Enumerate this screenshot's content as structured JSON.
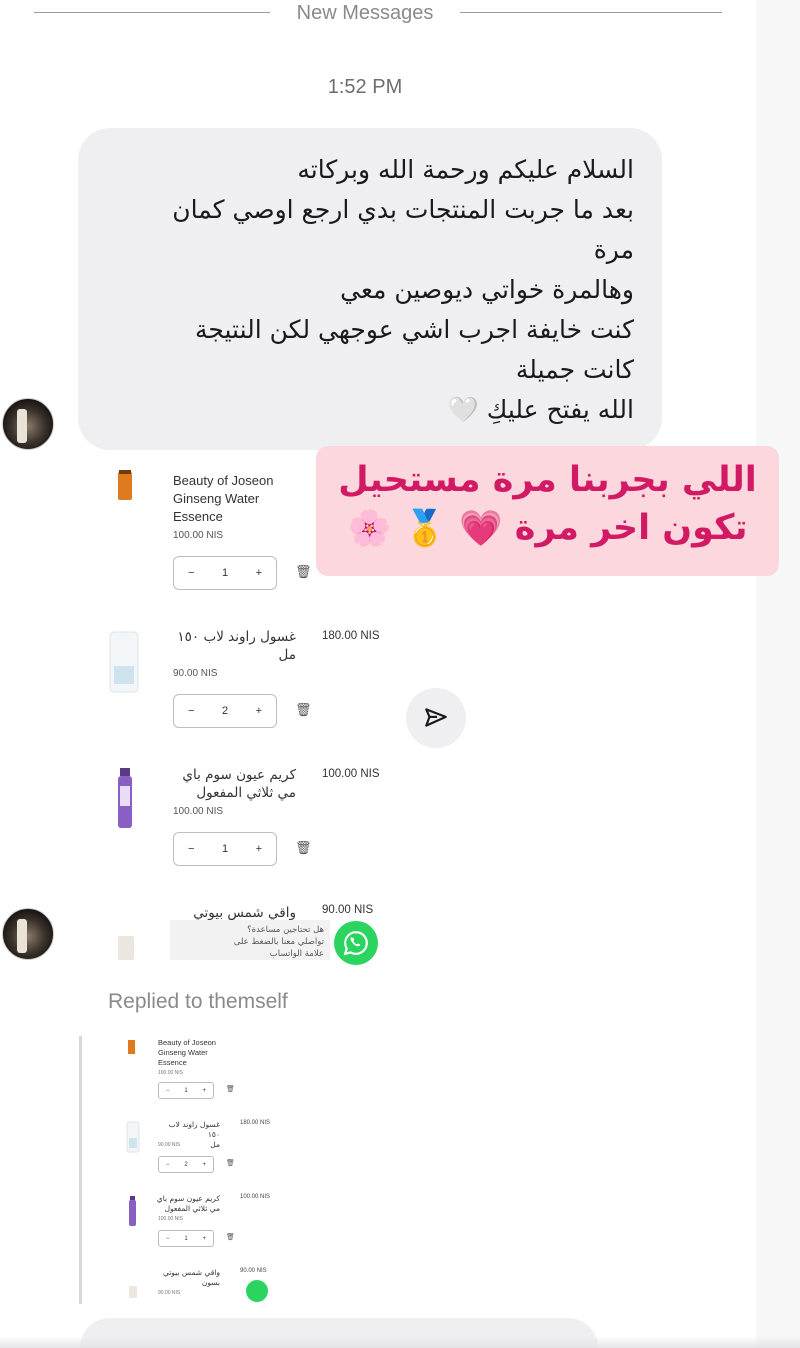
{
  "divider": {
    "label": "New Messages"
  },
  "timestamp": "1:52 PM",
  "message": {
    "lines": [
      "السلام عليكم ورحمة الله وبركاته",
      "بعد ما جربت المنتجات بدي ارجع اوصي كمان",
      "مرة",
      "وهالمرة خواتي ديوصين معي",
      "كنت خايفة اجرب اشي عوجهي لكن النتيجة",
      "كانت جميلة",
      "الله يفتح عليكِ 🤍"
    ]
  },
  "banner": {
    "line1": "اللي بجربنا مرة مستحيل",
    "line2": "تكون اخر مرة",
    "emojis": [
      "💗",
      "🥇",
      "🌸"
    ]
  },
  "cart": {
    "items": [
      {
        "name": "Beauty of Joseon Ginseng Water Essence",
        "name_lines": [
          "Beauty of Joseon",
          "Ginseng Water",
          "Essence"
        ],
        "unit_price": "100.00 NIS",
        "total": "",
        "qty": "1",
        "color": "#e07a1f"
      },
      {
        "name_lines": [
          "غسول راوند لاب ١٥٠",
          "مل"
        ],
        "unit_price": "90.00 NIS",
        "total": "180.00 NIS",
        "qty": "2",
        "color": "#cfe3ec"
      },
      {
        "name_lines": [
          "كريم عيون سوم باي",
          "مي ثلاثي المفعول"
        ],
        "unit_price": "100.00 NIS",
        "total": "100.00 NIS",
        "qty": "1",
        "color": "#7a4fb3"
      },
      {
        "name_lines": [
          "واقي شمس بيوتي",
          "بسون"
        ],
        "unit_price": "90.00 NIS",
        "total": "90.00 NIS",
        "qty": "",
        "color": "#ece6e0"
      }
    ],
    "whatsapp_tip_lines": [
      "هل تحتاجين مساعدة؟",
      "تواصلي معنا بالضغط على",
      "علامة الواتساب"
    ],
    "minus": "−",
    "plus": "+"
  },
  "reply": {
    "label": "Replied to themself"
  },
  "icons": {
    "send": "send-icon",
    "trash": "trash-icon",
    "whatsapp": "whatsapp-icon",
    "avatar": "avatar"
  },
  "colors": {
    "bubble": "#efeff1",
    "banner_bg": "#fcd7de",
    "banner_text": "#d21a64",
    "whatsapp": "#2bd45f"
  }
}
